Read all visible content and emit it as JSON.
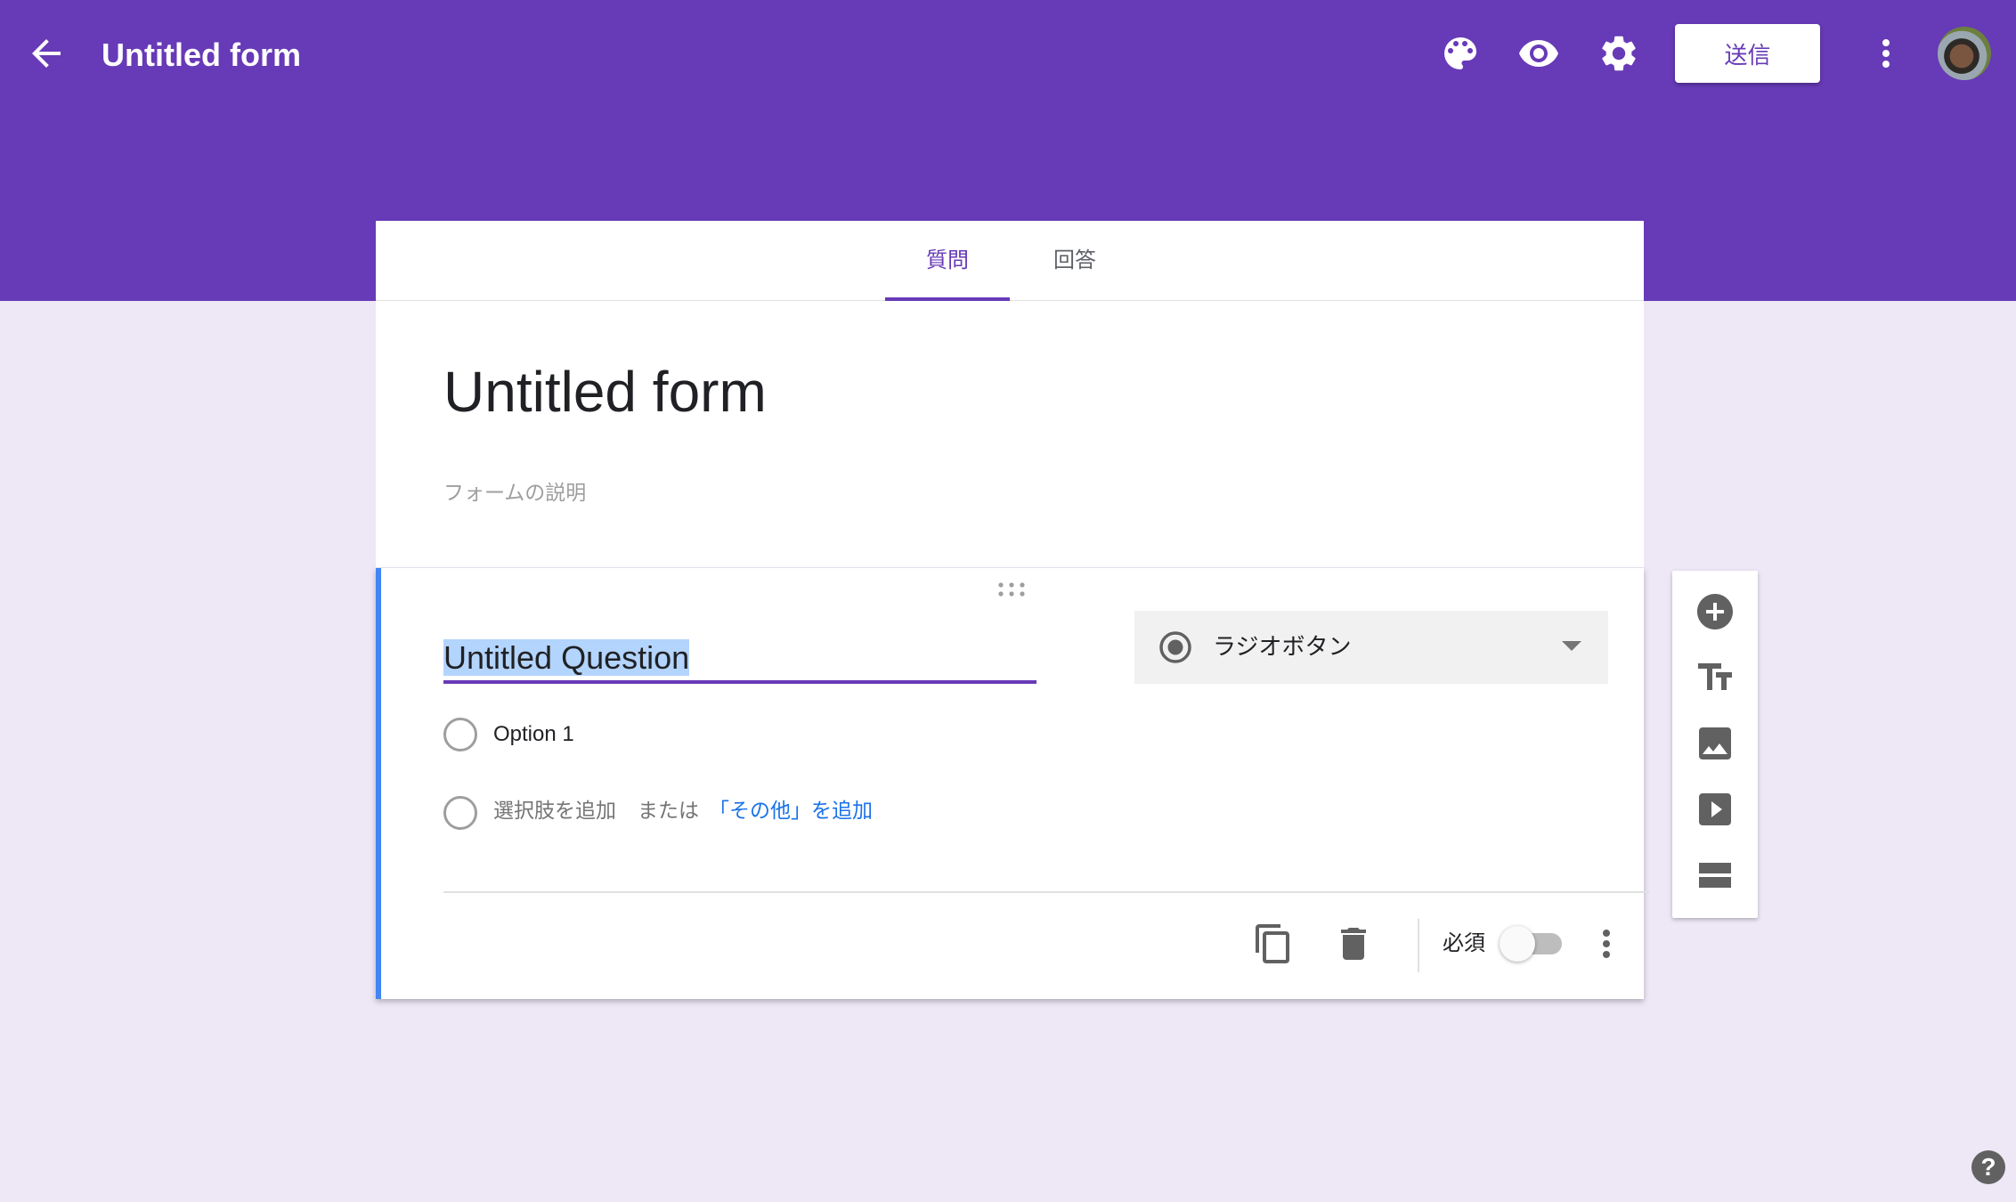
{
  "header": {
    "title": "Untitled form",
    "send_label": "送信",
    "icons": [
      "arrow-back-icon",
      "palette-icon",
      "eye-icon",
      "gear-icon",
      "more-vert-icon"
    ],
    "accent_color": "#673ab7"
  },
  "tabs": [
    {
      "label": "質問",
      "active": true
    },
    {
      "label": "回答",
      "active": false
    }
  ],
  "form": {
    "title": "Untitled form",
    "description_placeholder": "フォームの説明"
  },
  "question": {
    "title": "Untitled Question",
    "type": "ラジオボタン",
    "options": [
      "Option 1"
    ],
    "add_option": "選択肢を追加",
    "or": "または",
    "add_other": "「その他」を追加",
    "required_label": "必須",
    "required": false,
    "accent_color": "#4285f4"
  },
  "side_toolbar": {
    "icons": [
      "add-circle-icon",
      "title-text-icon",
      "image-icon",
      "video-icon",
      "section-icon"
    ]
  },
  "help": "?"
}
